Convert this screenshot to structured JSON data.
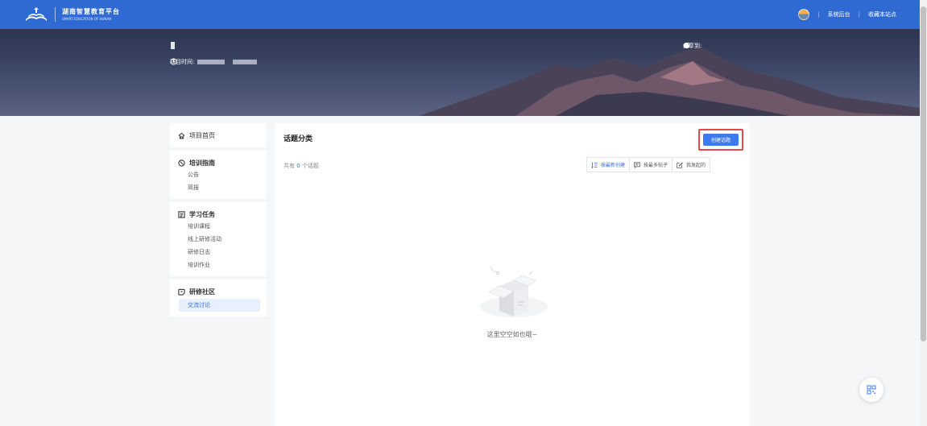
{
  "header": {
    "logo_cn": "湖南智慧教育平台",
    "logo_en": "SMART EDUCATION OF HUNAN",
    "links": [
      "系统后台",
      "收藏本站点"
    ],
    "brand_color": "#2e6ad1"
  },
  "banner": {
    "time_label": "项目时间:",
    "share_label": "分享到:",
    "share_icons": [
      "wechat-icon",
      "weibo-icon",
      "qq-icon"
    ]
  },
  "sidebar": {
    "home": "项目首页",
    "groups": [
      {
        "title": "培训指南",
        "icon": "guide-icon",
        "items": [
          "公告",
          "简报"
        ]
      },
      {
        "title": "学习任务",
        "icon": "task-icon",
        "items": [
          "培训课程",
          "线上研修活动",
          "研修日志",
          "培训作业"
        ]
      },
      {
        "title": "研修社区",
        "icon": "community-icon",
        "items": [
          "交流讨论"
        ]
      }
    ],
    "active_item": "交流讨论"
  },
  "main": {
    "title": "话题分类",
    "create_button": "创建话题",
    "count_prefix": "共有",
    "count_value": "0",
    "count_suffix": "个话题",
    "sort_options": [
      "按最新创建",
      "按最多帖子",
      "我发起的"
    ],
    "empty_text": "这里空空如也哦~"
  },
  "colors": {
    "accent": "#3d7af0",
    "highlight": "#e54848"
  }
}
